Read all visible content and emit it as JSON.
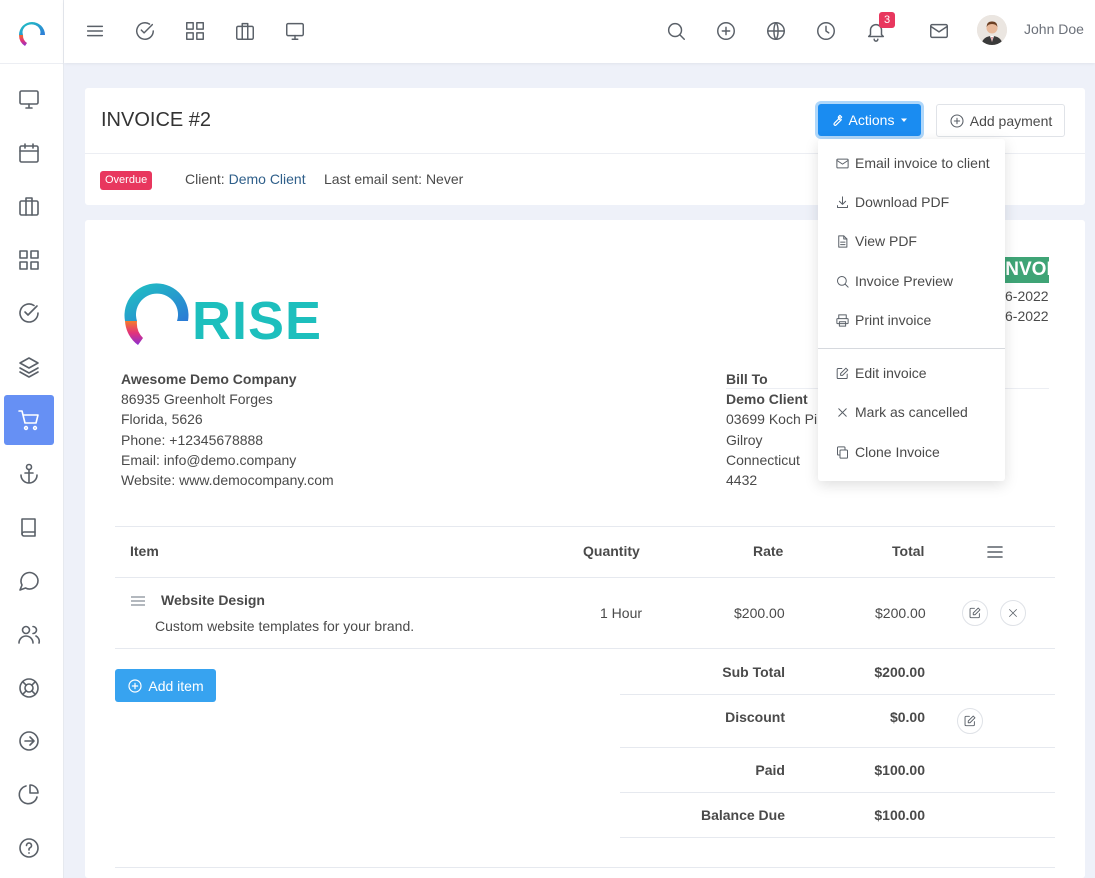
{
  "topbar": {
    "user_name": "John Doe",
    "notification_count": "3",
    "left_icons": [
      "menu-icon",
      "check-circle-icon",
      "grid-icon",
      "briefcase-icon",
      "monitor-icon"
    ],
    "right_icons": [
      "search-icon",
      "plus-circle-icon",
      "globe-icon",
      "clock-icon",
      "bell-icon",
      "mail-icon"
    ]
  },
  "sidebar": {
    "items": [
      "dashboard",
      "events",
      "projects",
      "clients",
      "tasks",
      "leads",
      "sales",
      "prospects",
      "notes",
      "messages",
      "team",
      "support",
      "expenses",
      "reports",
      "help"
    ],
    "active": "sales"
  },
  "header": {
    "title": "INVOICE #2",
    "actions_label": "Actions",
    "add_payment_label": "Add payment",
    "status": "Overdue",
    "client_prefix": "Client: ",
    "client_name": "Demo Client",
    "last_email": "Last email sent: Never"
  },
  "dropdown": {
    "items": [
      {
        "label": "Email invoice to client",
        "icon": "mail-icon"
      },
      {
        "label": "Download PDF",
        "icon": "download-icon"
      },
      {
        "label": "View PDF",
        "icon": "file-icon"
      },
      {
        "label": "Invoice Preview",
        "icon": "search-icon"
      },
      {
        "label": "Print invoice",
        "icon": "printer-icon"
      },
      {
        "label": "Edit invoice",
        "icon": "edit-icon"
      },
      {
        "label": "Mark as cancelled",
        "icon": "x-icon"
      },
      {
        "label": "Clone Invoice",
        "icon": "copy-icon"
      }
    ]
  },
  "invoice": {
    "logo_text": "RISE",
    "badge": "INVOICE #2",
    "date_line_1": "6-2022",
    "date_line_2": "6-2022",
    "company": {
      "name": "Awesome Demo Company",
      "address": "86935 Greenholt Forges",
      "city": "Florida, 5626",
      "phone": "Phone: +12345678888",
      "email": "Email: info@demo.company",
      "website": "Website: www.democompany.com"
    },
    "bill_to": {
      "label": "Bill To",
      "name": "Demo Client",
      "address": "03699 Koch Pin",
      "city": "Gilroy",
      "state": "Connecticut",
      "zip": "4432"
    },
    "table": {
      "headers": {
        "item": "Item",
        "quantity": "Quantity",
        "rate": "Rate",
        "total": "Total"
      },
      "rows": [
        {
          "title": "Website Design",
          "description": "Custom website templates for your brand.",
          "quantity": "1 Hour",
          "rate": "$200.00",
          "total": "$200.00"
        }
      ]
    },
    "add_item_label": "Add item",
    "summary": {
      "sub_total_label": "Sub Total",
      "sub_total": "$200.00",
      "discount_label": "Discount",
      "discount": "$0.00",
      "paid_label": "Paid",
      "paid": "$100.00",
      "balance_label": "Balance Due",
      "balance": "$100.00"
    }
  },
  "colors": {
    "primary": "#1a8cf1",
    "overdue": "#e8375e",
    "invoice_badge": "#3fa476",
    "sidebar_active": "#6690f4"
  }
}
